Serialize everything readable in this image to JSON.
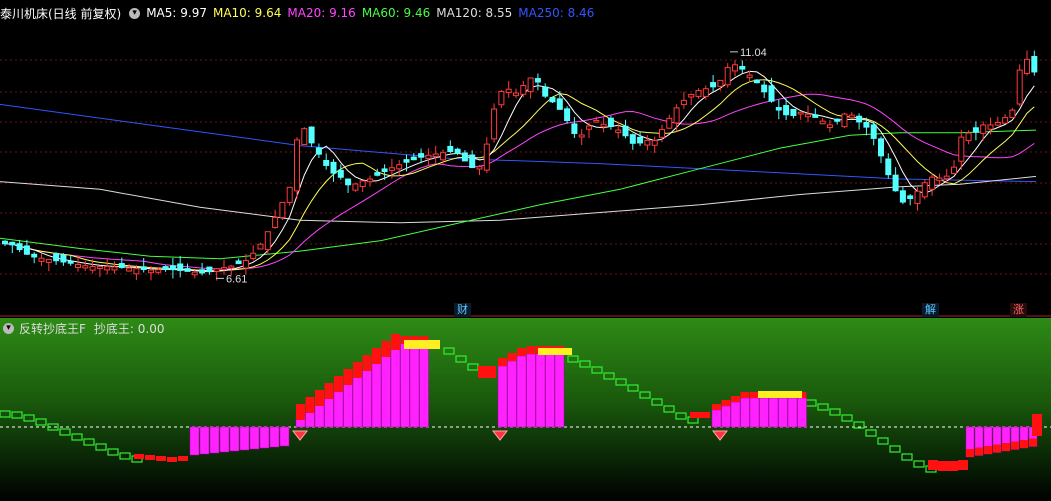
{
  "header": {
    "title": "泰川机床(日线 前复权)",
    "ma": [
      {
        "label": "MA5: 9.97",
        "color": "#ffffff"
      },
      {
        "label": "MA10: 9.64",
        "color": "#ffff55"
      },
      {
        "label": "MA20: 9.16",
        "color": "#ff44ff"
      },
      {
        "label": "MA60: 9.46",
        "color": "#44ff44"
      },
      {
        "label": "MA120: 8.55",
        "color": "#dddddd"
      },
      {
        "label": "MA250: 8.46",
        "color": "#3355ff"
      }
    ]
  },
  "price": {
    "high_label": "11.04",
    "low_label": "6.61",
    "ymin": 6.2,
    "ymax": 11.6,
    "colors": {
      "up": "#ff3a3a",
      "down": "#54ffff",
      "ma5": "#ffffff",
      "ma10": "#ffff55",
      "ma20": "#ff44ff",
      "ma60": "#44ff44",
      "ma120": "#dddddd",
      "ma250": "#3355ff"
    }
  },
  "events": [
    {
      "label": "财",
      "color": "#5cc8ff",
      "bg": "#0a1a2a"
    },
    {
      "label": "解",
      "color": "#5cc8ff",
      "bg": "#0a1a2a"
    },
    {
      "label": "涨",
      "color": "#ff6666",
      "bg": "#2a0a0a"
    }
  ],
  "indicator": {
    "title": "反转抄底王F",
    "value_label": "抄底王: 0.00",
    "colors": {
      "green": "#33ee33",
      "magenta": "#ff22ff",
      "red": "#ff1111",
      "yellow": "#ffee22"
    }
  }
}
